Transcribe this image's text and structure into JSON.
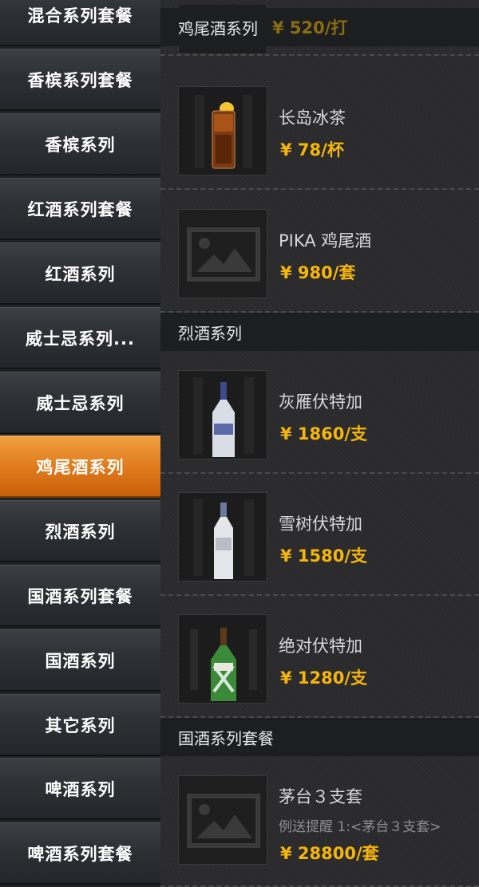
{
  "sidebar": {
    "items": [
      {
        "label": "混合系列套餐"
      },
      {
        "label": "香槟系列套餐"
      },
      {
        "label": "香槟系列"
      },
      {
        "label": "红酒系列套餐"
      },
      {
        "label": "红酒系列"
      },
      {
        "label": "威士忌系列..."
      },
      {
        "label": "威士忌系列"
      },
      {
        "label": "鸡尾酒系列",
        "active": true
      },
      {
        "label": "烈酒系列"
      },
      {
        "label": "国酒系列套餐"
      },
      {
        "label": "国酒系列"
      },
      {
        "label": "其它系列"
      },
      {
        "label": "啤酒系列"
      },
      {
        "label": "啤酒系列套餐"
      }
    ],
    "active_color": "#e07c1e"
  },
  "content": {
    "sticky_header": {
      "title": "鸡尾酒系列",
      "peek_price": "¥ 520/打"
    },
    "sections": [
      {
        "title": "鸡尾酒系列",
        "items": [
          {
            "name": "长岛冰茶",
            "price": "¥ 78/杯",
            "image": "long-island-iced-tea-image"
          },
          {
            "name": "PIKA 鸡尾酒",
            "price": "¥ 980/套",
            "image": "image-placeholder-icon"
          }
        ]
      },
      {
        "title": "烈酒系列",
        "items": [
          {
            "name": "灰雁伏特加",
            "price": "¥ 1860/支",
            "image": "grey-goose-bottle-image"
          },
          {
            "name": "雪树伏特加",
            "price": "¥ 1580/支",
            "image": "belvedere-bottle-image"
          },
          {
            "name": "绝对伏特加",
            "price": "¥ 1280/支",
            "image": "green-bottle-image"
          }
        ]
      },
      {
        "title": "国酒系列套餐",
        "items": [
          {
            "name": "茅台３支套",
            "note": "例送提醒 1:<茅台３支套>",
            "price": "¥ 28800/套",
            "image": "image-placeholder-icon"
          }
        ]
      }
    ]
  },
  "colors": {
    "price": "#f5b50a",
    "accent": "#e07c1e"
  }
}
